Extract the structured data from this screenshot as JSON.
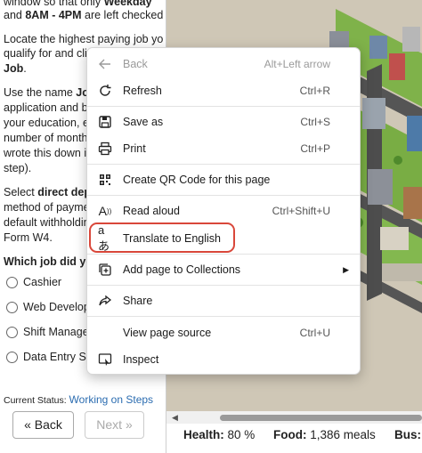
{
  "left": {
    "lines": [
      {
        "segments": [
          {
            "t": "window so that only ",
            "b": false
          },
          {
            "t": "Weekday",
            "b": true
          }
        ]
      },
      {
        "segments": [
          {
            "t": "and ",
            "b": false
          },
          {
            "t": "8AM - 4PM",
            "b": true
          },
          {
            "t": " are left checked.",
            "b": false
          }
        ]
      },
      {
        "segments": [
          {
            "t": "Locate the highest paying job you",
            "b": false
          }
        ]
      },
      {
        "segments": [
          {
            "t": "qualify for and click",
            "b": false
          }
        ]
      },
      {
        "segments": [
          {
            "t": "Job",
            "b": true
          },
          {
            "t": ".",
            "b": false
          }
        ]
      },
      {
        "segments": [
          {
            "t": "Use the name ",
            "b": false
          },
          {
            "t": "Joh",
            "b": true
          }
        ]
      },
      {
        "segments": [
          {
            "t": "application and be",
            "b": false
          }
        ]
      },
      {
        "segments": [
          {
            "t": "your education, ex",
            "b": false
          }
        ]
      },
      {
        "segments": [
          {
            "t": "number of months",
            "b": false
          }
        ]
      },
      {
        "segments": [
          {
            "t": "wrote this down in",
            "b": false
          }
        ]
      },
      {
        "segments": [
          {
            "t": "step).",
            "b": false
          }
        ]
      },
      {
        "segments": [
          {
            "t": "Select ",
            "b": false
          },
          {
            "t": "direct depo",
            "b": true
          }
        ]
      },
      {
        "segments": [
          {
            "t": "method of paymen",
            "b": false
          }
        ]
      },
      {
        "segments": [
          {
            "t": "default withholding",
            "b": false
          }
        ]
      },
      {
        "segments": [
          {
            "t": "Form W4.",
            "b": false
          }
        ]
      }
    ],
    "question": "Which job did you",
    "options": [
      "Cashier",
      "Web Develope",
      "Shift Manager",
      "Data Entry Sp"
    ],
    "status_label": "Current Status:",
    "status_value": "Working on Steps",
    "back_label": "« Back",
    "next_label": "Next »"
  },
  "stats": {
    "health_label": "Health:",
    "health_value": "80 %",
    "food_label": "Food:",
    "food_value": "1,386 meals",
    "bus_label": "Bus:"
  },
  "menu": {
    "items": [
      {
        "label": "Back",
        "shortcut": "Alt+Left arrow",
        "icon": "arrow-left-icon",
        "disabled": true
      },
      {
        "label": "Refresh",
        "shortcut": "Ctrl+R",
        "icon": "refresh-icon",
        "disabled": false
      },
      {
        "label": "Save as",
        "shortcut": "Ctrl+S",
        "icon": "save-icon",
        "disabled": false
      },
      {
        "label": "Print",
        "shortcut": "Ctrl+P",
        "icon": "printer-icon",
        "disabled": false
      },
      {
        "label": "Create QR Code for this page",
        "shortcut": "",
        "icon": "qr-code-icon",
        "disabled": false
      },
      {
        "label": "Read aloud",
        "shortcut": "Ctrl+Shift+U",
        "icon": "read-aloud-icon",
        "disabled": false
      },
      {
        "label": "Translate to English",
        "shortcut": "",
        "icon": "translate-icon",
        "disabled": false
      },
      {
        "label": "Add page to Collections",
        "shortcut": "",
        "icon": "collections-icon",
        "disabled": false
      },
      {
        "label": "Share",
        "shortcut": "",
        "icon": "share-icon",
        "disabled": false
      },
      {
        "label": "View page source",
        "shortcut": "Ctrl+U",
        "icon": "",
        "disabled": false
      },
      {
        "label": "Inspect",
        "shortcut": "",
        "icon": "inspect-icon",
        "disabled": false
      }
    ],
    "highlight_color": "#d9473a"
  }
}
